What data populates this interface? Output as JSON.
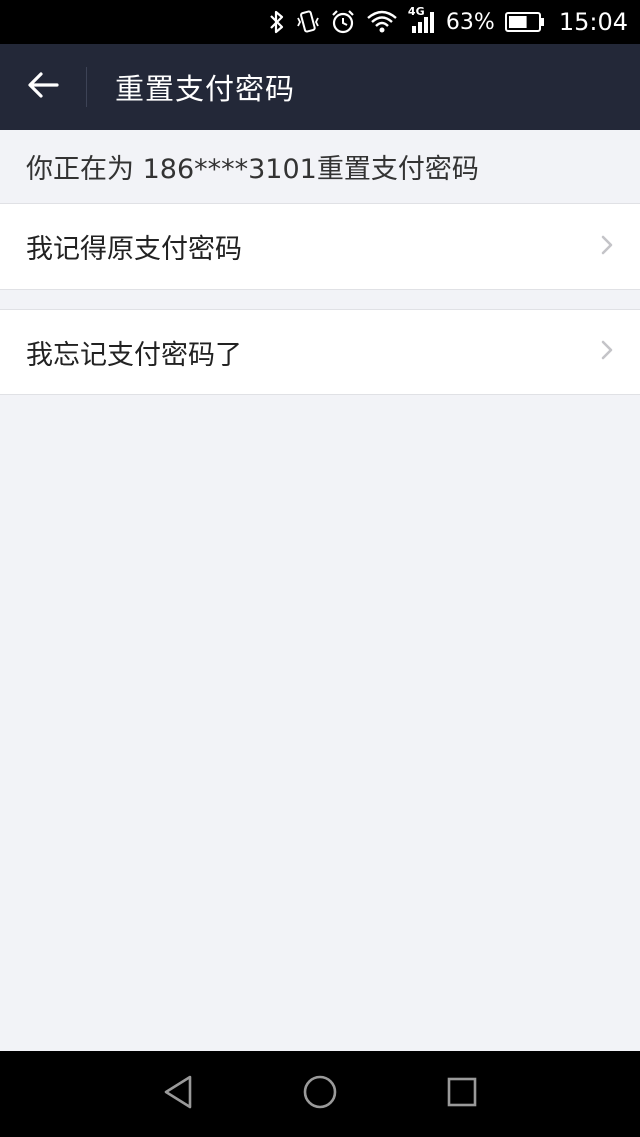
{
  "status_bar": {
    "battery_percent_text": "63%",
    "battery_level": 0.63,
    "network_label": "4G",
    "time": "15:04",
    "icons": [
      "bluetooth-icon",
      "vibrate-icon",
      "alarm-icon",
      "wifi-icon",
      "signal-icon",
      "battery-icon"
    ]
  },
  "app_bar": {
    "title": "重置支付密码",
    "back_icon": "back-arrow-icon"
  },
  "hint": {
    "text": "你正在为 186****3101重置支付密码"
  },
  "options": [
    {
      "label": "我记得原支付密码",
      "icon": "chevron-right-icon"
    },
    {
      "label": "我忘记支付密码了",
      "icon": "chevron-right-icon"
    }
  ],
  "nav_bar": {
    "icons": [
      "back-triangle-icon",
      "home-circle-icon",
      "recents-square-icon"
    ]
  },
  "colors": {
    "app_bar_bg": "#232838",
    "page_bg": "#f2f3f7",
    "row_bg": "#ffffff",
    "chevron": "#c4c4c8"
  }
}
